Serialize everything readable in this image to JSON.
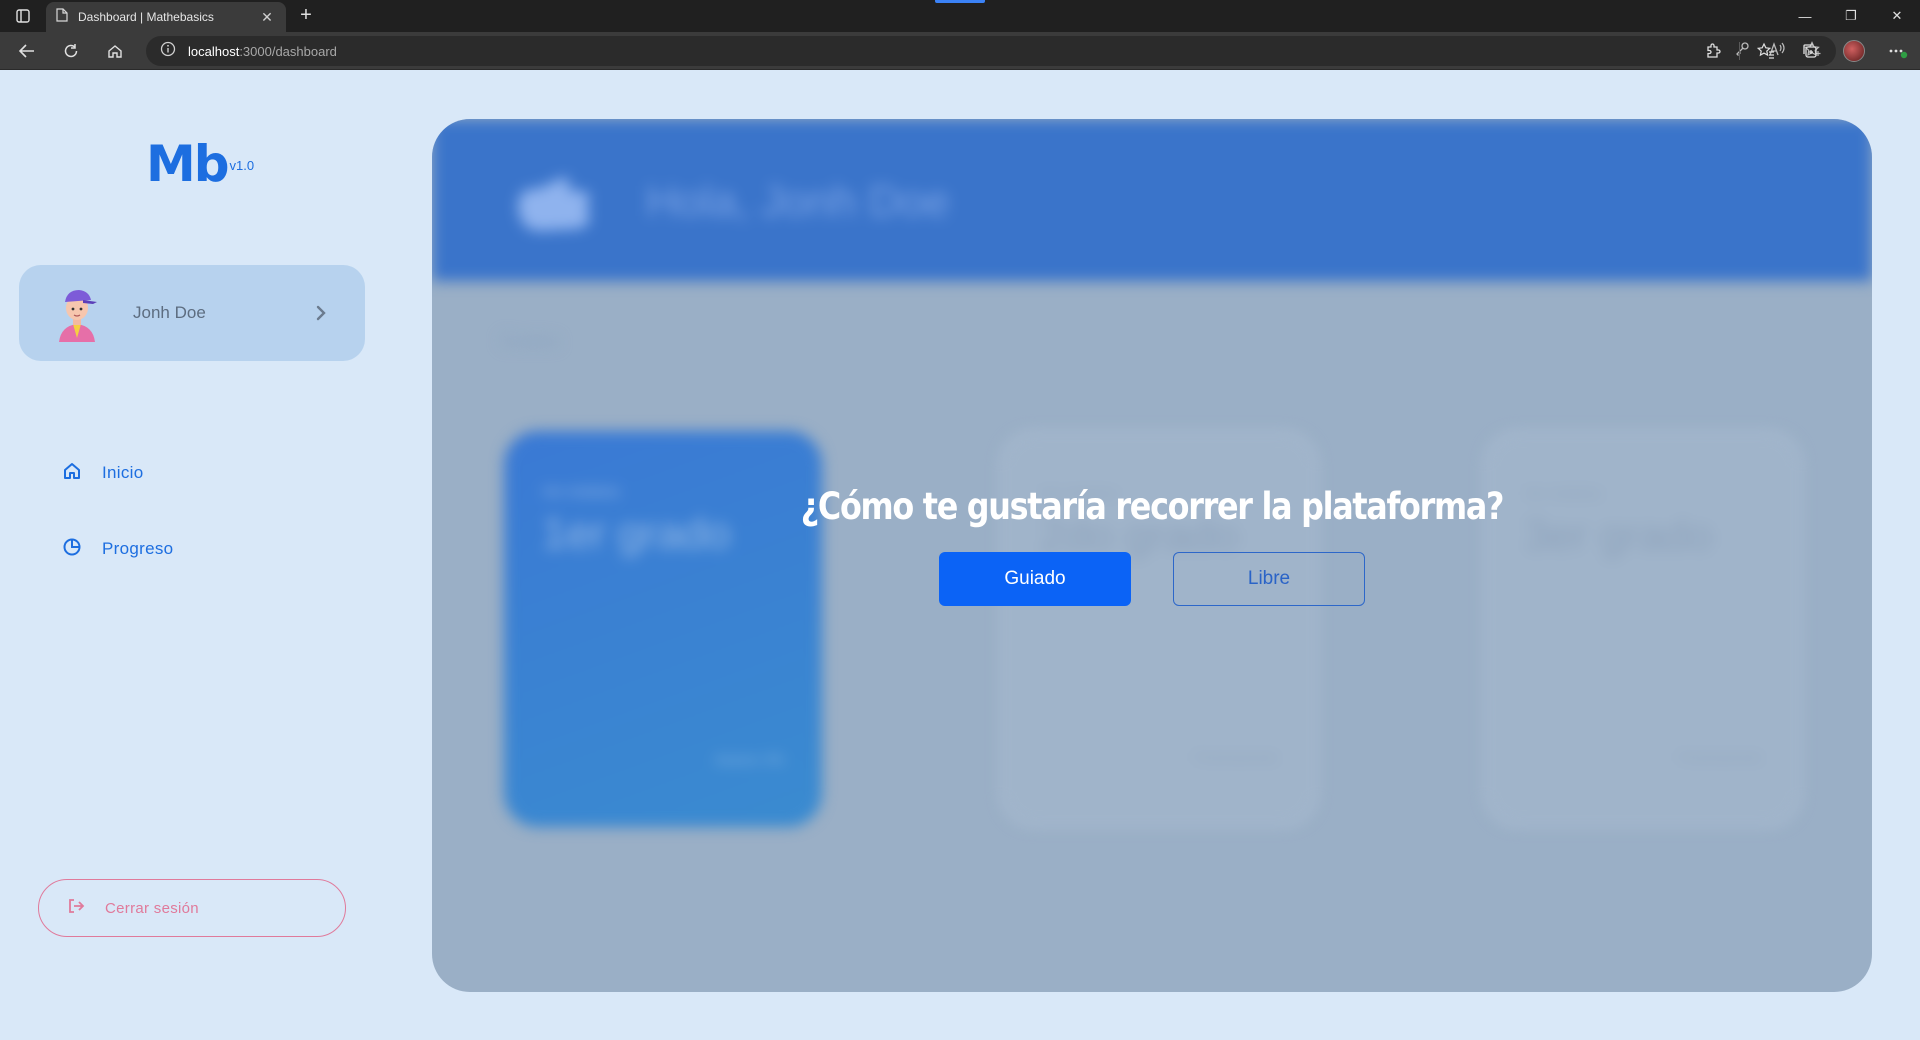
{
  "browser": {
    "tab_title": "Dashboard | Mathebasics",
    "url_host": "localhost",
    "url_path": ":3000/dashboard"
  },
  "logo": {
    "mark": "Mb",
    "version": "v1.0"
  },
  "profile": {
    "name": "Jonh Doe",
    "avatar_icon": "avatar-icon"
  },
  "nav": {
    "items": [
      {
        "label": "Inicio",
        "icon": "home-icon"
      },
      {
        "label": "Progreso",
        "icon": "progress-icon"
      }
    ]
  },
  "logout": {
    "label": "Cerrar sesión",
    "icon": "logout-icon"
  },
  "main": {
    "greeting": "Hola, Jonh Doe",
    "section_title": "Grados",
    "cards": [
      {
        "kicker": "Ver módulos",
        "grade": "1er grado",
        "footer": "Avance: 0%"
      },
      {
        "kicker": "Ver módulos",
        "grade": "2do grado",
        "footer": "Próximamente"
      },
      {
        "kicker": "Ver módulos",
        "grade": "3er grado",
        "footer": "Próximamente"
      }
    ]
  },
  "modal": {
    "question": "¿Cómo te gustaría recorrer la plataforma?",
    "guided_label": "Guiado",
    "free_label": "Libre"
  },
  "colors": {
    "accent": "#1d6ee0",
    "primary_button": "#0b63f6",
    "logout": "#e07a9b",
    "page_bg": "#d9e8f8"
  }
}
